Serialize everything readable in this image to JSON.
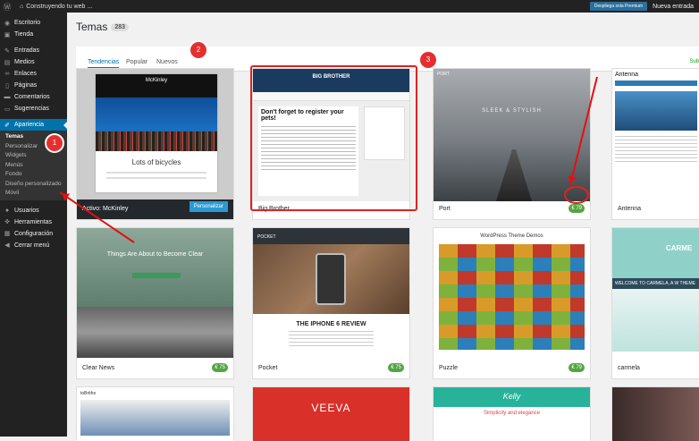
{
  "adminbar": {
    "site_name": "Construyendo tu web ...",
    "preview_label": "Despliega sola Premium",
    "new_label": "Nueva entrada"
  },
  "menu": {
    "items": [
      {
        "label": "Escritorio",
        "icon": "dashboard-icon"
      },
      {
        "label": "Tienda",
        "icon": "cart-icon"
      },
      {
        "label": "Entradas",
        "icon": "pin-icon"
      },
      {
        "label": "Medios",
        "icon": "media-icon"
      },
      {
        "label": "Enlaces",
        "icon": "link-icon"
      },
      {
        "label": "Páginas",
        "icon": "page-icon"
      },
      {
        "label": "Comentarios",
        "icon": "comment-icon"
      },
      {
        "label": "Sugerencias",
        "icon": "feedback-icon"
      },
      {
        "label": "Apariencia",
        "icon": "brush-icon"
      }
    ],
    "sub": [
      "Temas",
      "Personalizar",
      "Widgets",
      "Menús",
      "Fondo",
      "Diseño personalizado",
      "Móvil"
    ],
    "items2": [
      {
        "label": "Usuarios",
        "icon": "users-icon"
      },
      {
        "label": "Herramientas",
        "icon": "wrench-icon"
      },
      {
        "label": "Configuración",
        "icon": "settings-icon"
      },
      {
        "label": "Cerrar menú",
        "icon": "collapse-icon"
      }
    ]
  },
  "page": {
    "title": "Temas",
    "count": "283"
  },
  "tabs": [
    "Tendencias",
    "Popular",
    "Nuevos"
  ],
  "upload_label": "Sub",
  "cards": [
    {
      "name": "Activo: McKinley",
      "button": "Personalizar"
    },
    {
      "name": "Big Brother"
    },
    {
      "name": "Port",
      "price": "€ 79"
    },
    {
      "name": "Antenna"
    },
    {
      "name": "Clear News",
      "price": "€ 75"
    },
    {
      "name": "Pocket",
      "price": "€ 75"
    },
    {
      "name": "Puzzle",
      "price": "€ 79"
    },
    {
      "name": "carmela"
    }
  ],
  "shots": {
    "mckinley_title": "McKinley",
    "mckinley_caption": "Lots of bicycles",
    "bb_title": "BIG BROTHER",
    "bb_heading": "Don't forget to register your pets!",
    "port_tag": "SLEEK & STYLISH",
    "port_logo": "PORT",
    "antenna_title": "Antenna",
    "clearnews_tag": "Things Are About to Become Clear",
    "pocket_logo": "POCKET",
    "pocket_heading": "THE IPHONE 6 REVIEW",
    "puzzle_title": "WordPress Theme Demos",
    "carmela_title": "CARME",
    "carmela_sub": "WELCOME TO CARMELA, A W THEME",
    "row3_b": "VEEVA",
    "row3_c": "Kelly",
    "row3_c_sub": "Simplicity and elegance",
    "row3_a": "toBrithe"
  },
  "annotations": [
    "1",
    "2",
    "3"
  ],
  "colors": {
    "accent": "#0073aa",
    "price": "#54a543",
    "annotation": "#e02222"
  }
}
